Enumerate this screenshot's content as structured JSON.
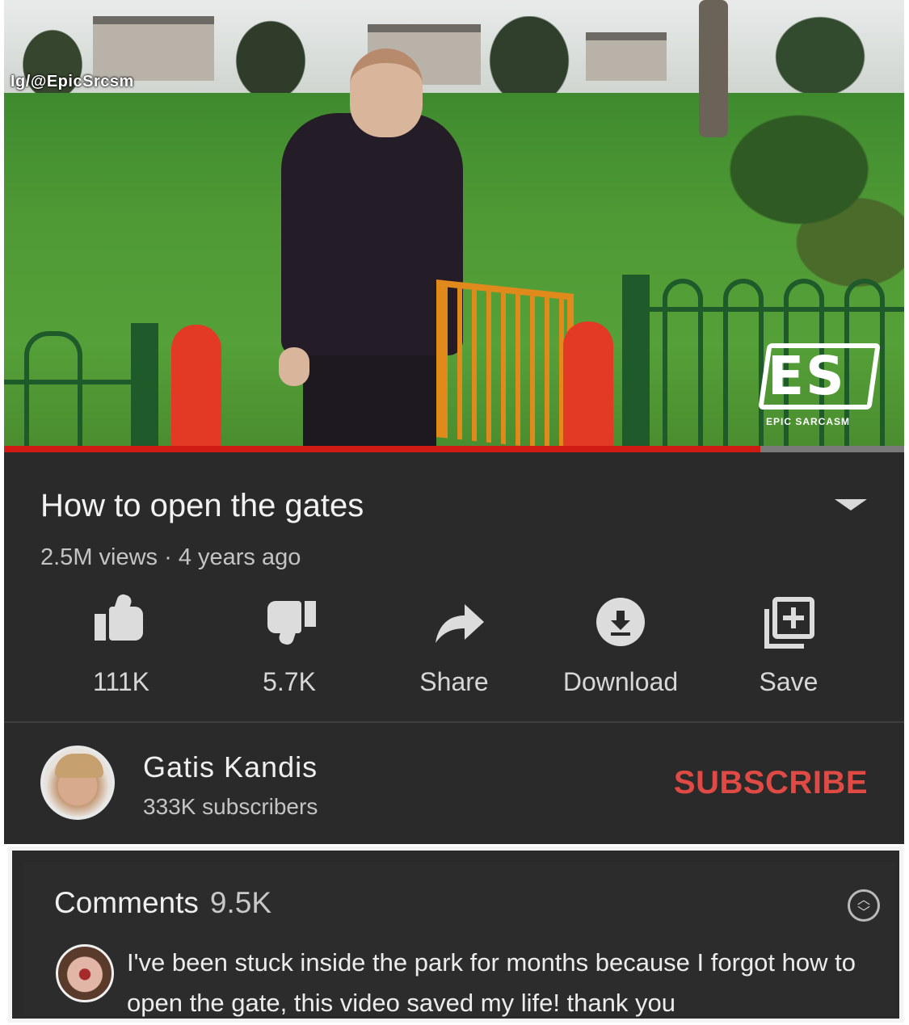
{
  "video": {
    "watermark": "Ig/@EpicSrcsm",
    "logo_letters": "ES",
    "logo_text": "EPIC SARCASM",
    "progress_fraction": 0.84
  },
  "info": {
    "title": "How to open the gates",
    "meta": "2.5M views · 4 years ago",
    "actions": [
      {
        "icon": "thumbs-up-icon",
        "label": "111K"
      },
      {
        "icon": "thumbs-down-icon",
        "label": "5.7K"
      },
      {
        "icon": "share-icon",
        "label": "Share"
      },
      {
        "icon": "download-icon",
        "label": "Download"
      },
      {
        "icon": "save-playlist-icon",
        "label": "Save"
      }
    ]
  },
  "channel": {
    "name": "Gatis Kandis",
    "subscribers": "333K subscribers",
    "subscribe_label": "SUBSCRIBE"
  },
  "comments": {
    "label": "Comments",
    "count": "9.5K",
    "top_comment": "I've been stuck inside the park for months because I forgot how to open the gate, this video saved my life! thank you"
  },
  "colors": {
    "panel": "#2a2a2a",
    "subscribe": "#e04a45",
    "progress": "#d01b14"
  }
}
